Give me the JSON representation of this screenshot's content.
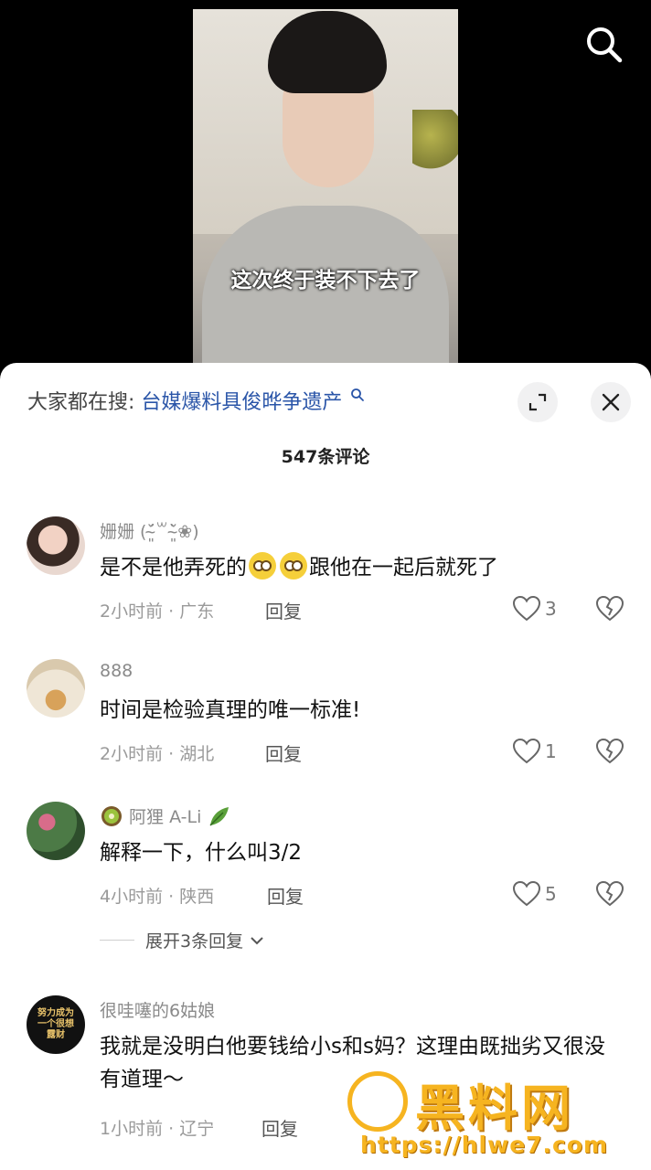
{
  "video": {
    "caption": "这次终于装不下去了"
  },
  "header": {
    "search_label": "大家都在搜:",
    "search_query": "台媒爆料具俊晔争遗产"
  },
  "comment_count": "547条评论",
  "comments": [
    {
      "name": "姗姗 (˘̴͈́꒳˘̴͈̀❀)",
      "text_before": "是不是他弄死的",
      "text_after": "跟他在一起后就死了",
      "time_location": "2小时前 · 广东",
      "reply": "回复",
      "likes": "3"
    },
    {
      "name": "888",
      "text": "时间是检验真理的唯一标准!",
      "time_location": "2小时前 · 湖北",
      "reply": "回复",
      "likes": "1"
    },
    {
      "name": "阿狸 A-Li",
      "text": "解释一下，什么叫3/2",
      "time_location": "4小时前 · 陕西",
      "reply": "回复",
      "likes": "5",
      "expand_label": "展开3条回复"
    },
    {
      "name": "很哇噻的6姑娘",
      "avatar_text": "努力成为一个很想露财",
      "text": "我就是没明白他要钱给小s和s妈？这理由既拙劣又很没有道理～",
      "time_location": "1小时前 · 辽宁",
      "reply": "回复"
    }
  ],
  "watermark": {
    "title": "黑料网",
    "url": "https://hlwe7.com"
  },
  "colors": {
    "query_link": "#2a55a8",
    "watermark": "#f6b420"
  }
}
